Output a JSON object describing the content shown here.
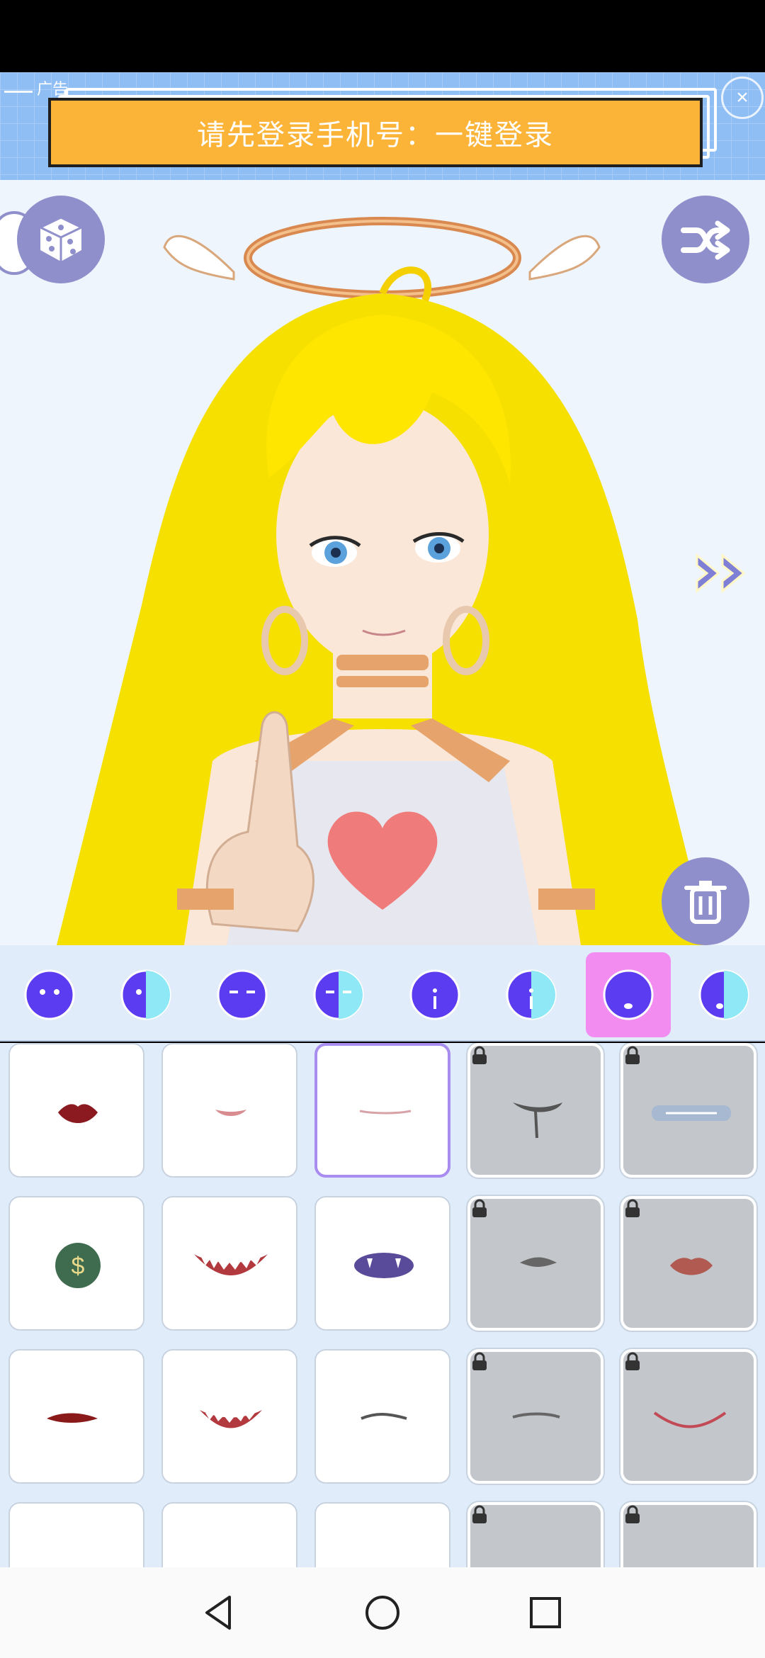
{
  "ad": {
    "tag": "广告",
    "button_label": "请先登录手机号：一键登录",
    "close_glyph": "×"
  },
  "toolbar": {
    "left_icon": "dice-icon",
    "right_icon": "shuffle-icon",
    "delete_icon": "trash-icon",
    "next_icon": "double-chevron-right-icon"
  },
  "categories": [
    {
      "name": "face-full",
      "selected": false
    },
    {
      "name": "face-half",
      "selected": false
    },
    {
      "name": "eyes-full",
      "selected": false
    },
    {
      "name": "eyes-half",
      "selected": false
    },
    {
      "name": "nose-full",
      "selected": false
    },
    {
      "name": "nose-half",
      "selected": false
    },
    {
      "name": "mouth-full",
      "selected": true
    },
    {
      "name": "mouth-half",
      "selected": false
    }
  ],
  "mouth_options": [
    {
      "id": 1,
      "locked": false,
      "selected": false,
      "style": "red-lips"
    },
    {
      "id": 2,
      "locked": false,
      "selected": false,
      "style": "small-pink-lips"
    },
    {
      "id": 3,
      "locked": false,
      "selected": true,
      "style": "thin-line"
    },
    {
      "id": 4,
      "locked": true,
      "selected": false,
      "style": "drool"
    },
    {
      "id": 5,
      "locked": true,
      "selected": false,
      "style": "bandage"
    },
    {
      "id": 6,
      "locked": false,
      "selected": false,
      "style": "dollar-coin"
    },
    {
      "id": 7,
      "locked": false,
      "selected": false,
      "style": "shark-grin"
    },
    {
      "id": 8,
      "locked": false,
      "selected": false,
      "style": "purple-fangs"
    },
    {
      "id": 9,
      "locked": true,
      "selected": false,
      "style": "small-fangs"
    },
    {
      "id": 10,
      "locked": true,
      "selected": false,
      "style": "glossy-lips"
    },
    {
      "id": 11,
      "locked": false,
      "selected": false,
      "style": "bloody-fang"
    },
    {
      "id": 12,
      "locked": false,
      "selected": false,
      "style": "sharp-teeth"
    },
    {
      "id": 13,
      "locked": false,
      "selected": false,
      "style": "smirk"
    },
    {
      "id": 14,
      "locked": true,
      "selected": false,
      "style": "frown"
    },
    {
      "id": 15,
      "locked": true,
      "selected": false,
      "style": "smile"
    },
    {
      "id": 16,
      "locked": false,
      "selected": false,
      "style": "grin"
    },
    {
      "id": 17,
      "locked": false,
      "selected": false,
      "style": "pink-small"
    },
    {
      "id": 18,
      "locked": false,
      "selected": false,
      "style": "pink-line"
    },
    {
      "id": 19,
      "locked": true,
      "selected": false,
      "style": "dark-lips"
    },
    {
      "id": 20,
      "locked": true,
      "selected": false,
      "style": "vampire"
    }
  ],
  "navbar": {
    "back_icon": "back-triangle-icon",
    "home_icon": "home-circle-icon",
    "recents_icon": "recents-square-icon"
  }
}
